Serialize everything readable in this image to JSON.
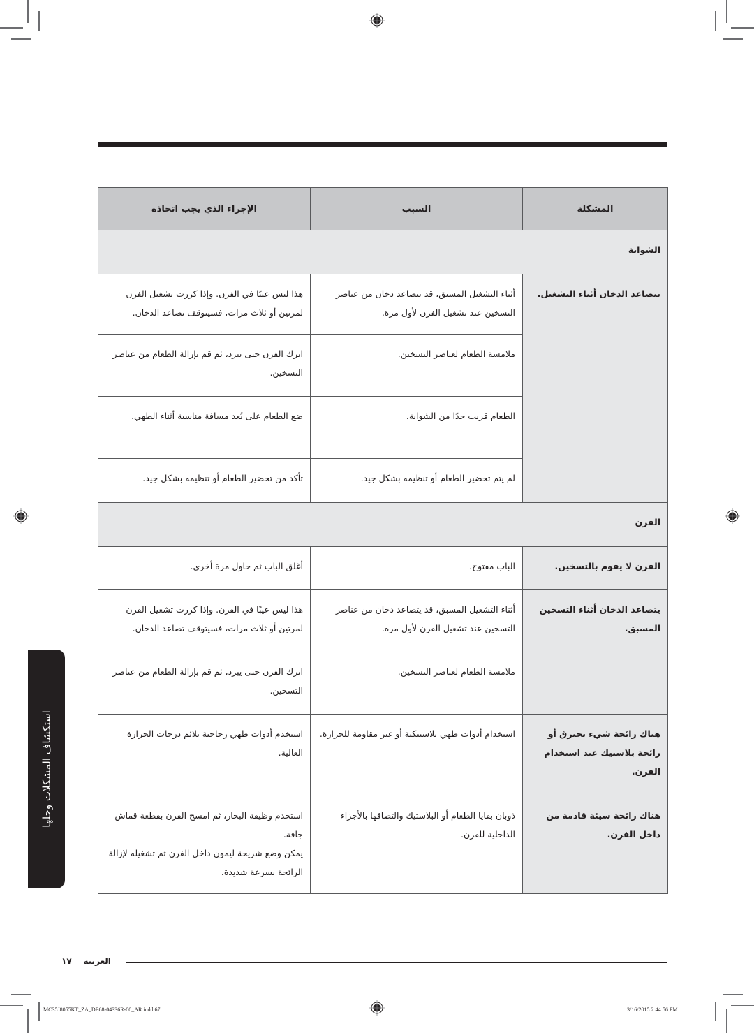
{
  "table": {
    "headers": {
      "problem": "المشكلة",
      "cause": "السبب",
      "action": "الإجراء الذي يجب اتخاذه"
    },
    "sections": [
      {
        "title": "الشواية",
        "problems": [
          {
            "problem": "يتصاعد الدخان أثناء التشغيل.",
            "rows": [
              {
                "cause": "أثناء التشغيل المسبق، قد يتصاعد دخان من عناصر التسخين عند تشغيل الفرن لأول مرة.",
                "action": "هذا ليس عيبًا في الفرن. وإذا كررت تشغيل الفرن لمرتين أو ثلاث مرات، فسيتوقف تصاعد الدخان."
              },
              {
                "cause": "ملامسة الطعام لعناصر التسخين.",
                "action": "اترك الفرن حتى يبرد، ثم قم بإزالة الطعام من عناصر التسخين."
              },
              {
                "cause": "الطعام قريب جدًا من الشواية.",
                "action": "ضع الطعام على بُعد مسافة مناسبة أثناء الطهي."
              },
              {
                "cause": "لم يتم تحضير الطعام أو تنظيمه بشكل جيد.",
                "action": "تأكد من تحضير الطعام أو تنظيمه بشكل جيد."
              }
            ]
          }
        ]
      },
      {
        "title": "الفرن",
        "problems": [
          {
            "problem": "الفرن لا يقوم بالتسخين.",
            "rows": [
              {
                "cause": "الباب مفتوح.",
                "action": "أغلق الباب ثم حاول مرة أخرى."
              }
            ]
          },
          {
            "problem": "يتصاعد الدخان أثناء التسخين المسبق.",
            "rows": [
              {
                "cause": "أثناء التشغيل المسبق، قد يتصاعد دخان من عناصر التسخين عند تشغيل الفرن لأول مرة.",
                "action": "هذا ليس عيبًا في الفرن. وإذا كررت تشغيل الفرن لمرتين أو ثلاث مرات، فسيتوقف تصاعد الدخان."
              },
              {
                "cause": "ملامسة الطعام لعناصر التسخين.",
                "action": "اترك الفرن حتى يبرد، ثم قم بإزالة الطعام من عناصر التسخين."
              }
            ]
          },
          {
            "problem": "هناك رائحة شيء يحترق أو رائحة بلاستيك عند استخدام الفرن.",
            "rows": [
              {
                "cause": "استخدام أدوات طهي بلاستيكية أو غير مقاومة للحرارة.",
                "action": "استخدم أدوات طهي زجاجية تلائم درجات الحرارة العالية."
              }
            ]
          },
          {
            "problem": "هناك رائحة سيئة قادمة من داخل الفرن.",
            "rows": [
              {
                "cause": "ذوبان بقايا الطعام أو البلاستيك والتصاقها بالأجزاء الداخلية للفرن.",
                "action": "استخدم وظيفة البخار، ثم امسح الفرن بقطعة قماش جافة.\nيمكن وضع شريحة ليمون داخل الفرن ثم تشغيله لإزالة الرائحة بسرعة شديدة."
              }
            ]
          }
        ]
      }
    ]
  },
  "side_tab": {
    "label": "استكشاف المشكلات وحلها"
  },
  "footer": {
    "language": "العربية",
    "page_number": "١٧"
  },
  "slug": {
    "file": "MC35J8055KT_ZA_DE68-04336R-00_AR.indd   67",
    "timestamp": "3/16/2015   2:44:56 PM"
  }
}
